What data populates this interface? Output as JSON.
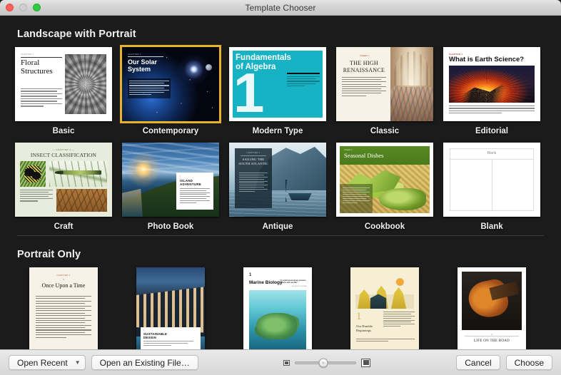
{
  "window": {
    "title": "Template Chooser",
    "traffic_lights": [
      "close-red",
      "minimize-inactive",
      "zoom-green"
    ]
  },
  "sections": [
    {
      "title": "Landscape with Portrait",
      "rows": [
        [
          {
            "label": "Basic",
            "selected": false,
            "art": "basic",
            "chapter": "CHAPTER 1",
            "title": "Floral\nStructures"
          },
          {
            "label": "Contemporary",
            "selected": true,
            "art": "contemp",
            "chapter": "CHAPTER 1",
            "title": "Our Solar\nSystem"
          },
          {
            "label": "Modern Type",
            "selected": false,
            "art": "modern",
            "chapter": "1",
            "title": "Fundamentals\nof Algebra"
          },
          {
            "label": "Classic",
            "selected": false,
            "art": "classic",
            "chapter": "Chapter 1",
            "title": "THE HIGH\nRENAISSANCE"
          },
          {
            "label": "Editorial",
            "selected": false,
            "art": "editorial",
            "chapter": "CHAPTER 1",
            "title": "What is Earth Science?"
          }
        ],
        [
          {
            "label": "Craft",
            "selected": false,
            "art": "craft",
            "chapter": "— CHAPTER 1 —",
            "title": "INSECT CLASSIFICATION"
          },
          {
            "label": "Photo Book",
            "selected": false,
            "art": "photo",
            "chapter": "1",
            "title": "ISLAND\nADVENTURE"
          },
          {
            "label": "Antique",
            "selected": false,
            "art": "antique",
            "chapter": "CHAPTER 1",
            "title": "SAILING THE\nSOUTH ATLANTIC"
          },
          {
            "label": "Cookbook",
            "selected": false,
            "art": "cook",
            "chapter": "Chapter 1",
            "title": "Seasonal Dishes"
          },
          {
            "label": "Blank",
            "selected": false,
            "art": "blank",
            "chapter": "",
            "title": "Blank"
          }
        ]
      ]
    },
    {
      "title": "Portrait Only",
      "rows": [
        [
          {
            "label": "",
            "selected": false,
            "art": "story",
            "chapter": "CHAPTER 1",
            "title": "Once Upon a Time"
          },
          {
            "label": "",
            "selected": false,
            "art": "sust",
            "chapter": "1",
            "title": "SUSTAINABLE\nDESIGN"
          },
          {
            "label": "",
            "selected": false,
            "art": "marine",
            "chapter": "1",
            "title": "Marine Biology",
            "quote": "“A small quote about science, oceans and sea life.”",
            "quote_author": "— JACQUES COUSTEAU"
          },
          {
            "label": "",
            "selected": false,
            "art": "humble",
            "chapter": "1",
            "title": "Our Humble Beginnings"
          },
          {
            "label": "",
            "selected": false,
            "art": "road",
            "chapter": "1",
            "title": "LIFE ON THE ROAD"
          }
        ]
      ]
    }
  ],
  "toolbar": {
    "open_recent_label": "Open Recent",
    "open_recent_chevron": "chevron-down-icon",
    "open_existing_label": "Open an Existing File…",
    "zoom_small_icon": "small-thumbnail-icon",
    "zoom_large_icon": "large-thumbnail-icon",
    "zoom_value": 46,
    "cancel_label": "Cancel",
    "choose_label": "Choose"
  },
  "colors": {
    "selection": "#e8b22a",
    "background": "#1b1b1b",
    "titlebar": "#d8d8d8"
  }
}
